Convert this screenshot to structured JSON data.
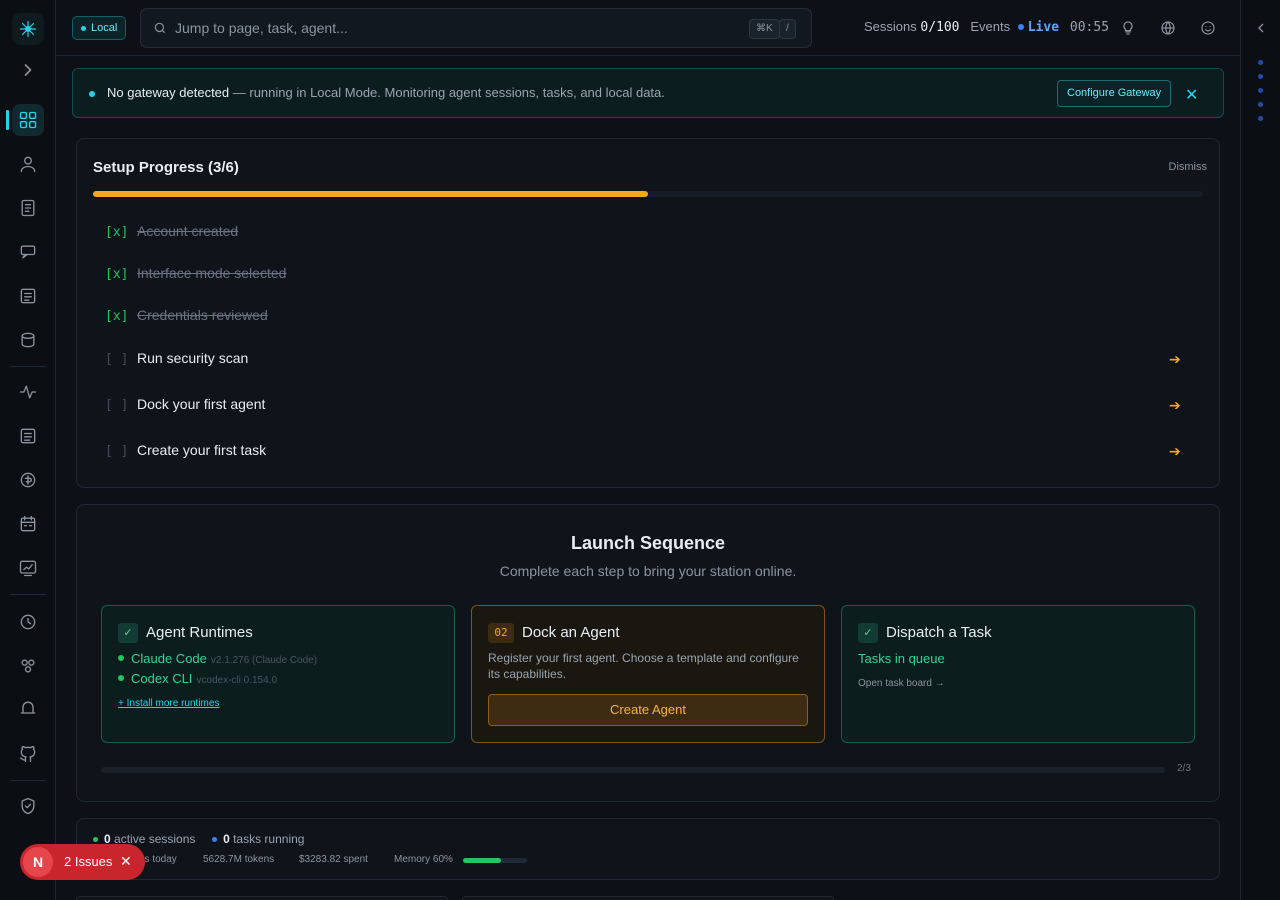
{
  "topbar": {
    "mode_badge": "Local",
    "search_placeholder": "Jump to page, task, agent...",
    "kbd_shortcut": "⌘K",
    "kbd_slash": "/",
    "sessions_label": "Sessions",
    "sessions_value": "0/100",
    "events_label": "Events",
    "live_label": "Live",
    "timer": "00:55"
  },
  "banner": {
    "title": "No gateway detected",
    "message": " — running in Local Mode. Monitoring agent sessions, tasks, and local data.",
    "configure_label": "Configure Gateway",
    "close_glyph": "✕"
  },
  "setup": {
    "title": "Setup Progress (3/6)",
    "dismiss_label": "Dismiss",
    "progress": 0.5,
    "progress_color": "#f5a623",
    "tasks": [
      {
        "box": "[x]",
        "label": "Account created"
      },
      {
        "box": "[x]",
        "label": "Interface mode selected"
      },
      {
        "box": "[x]",
        "label": "Credentials reviewed"
      },
      {
        "box": "[ ]",
        "label": "Run security scan"
      },
      {
        "box": "[ ]",
        "label": "Dock your first agent"
      },
      {
        "box": "[ ]",
        "label": "Create your first task"
      }
    ],
    "arrow_glyph": "➔"
  },
  "launch": {
    "title": "Launch Sequence",
    "subtitle": "Complete each step to bring your station online.",
    "steps": [
      {
        "badge": "✓",
        "title": "Agent Runtimes",
        "runtimes": [
          {
            "name": "Claude Code",
            "version": "v2.1.276 (Claude Code)"
          },
          {
            "name": "Codex CLI",
            "version": "vcodex-cli 0.154.0"
          }
        ],
        "link": "+ Install more runtimes"
      },
      {
        "badge": "02",
        "title": "Dock an Agent",
        "description": "Register your first agent. Choose a template and configure its capabilities.",
        "button": "Create Agent"
      },
      {
        "badge": "✓",
        "title": "Dispatch a Task",
        "status": "Tasks in queue",
        "link": "Open task board →"
      }
    ],
    "sequence_label": "2/3"
  },
  "stats": {
    "active_sessions_value": "0",
    "active_sessions_label": " active sessions",
    "tasks_running_value": "0",
    "tasks_running_label": " tasks running",
    "sessions_today": "ns today",
    "tokens": "5628.7M tokens",
    "spent": "$3283.82 spent",
    "memory_label": "Memory 60%",
    "memory_value": 0.6
  },
  "issues": {
    "avatar_letter": "N",
    "label": "2 Issues",
    "close_glyph": "✕"
  },
  "colors": {
    "accent": "#22d3ee",
    "success": "#22c55e",
    "warning": "#f5a623",
    "danger": "#c9252c"
  }
}
